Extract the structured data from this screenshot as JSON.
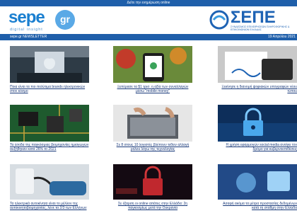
{
  "topbar": {
    "text": "Δείτε την ενημέρωση online"
  },
  "brand_left": {
    "word": "sepe",
    "badge": "gr",
    "tagline": "digital insight"
  },
  "brand_right": {
    "word": "ΣΕΠΕ",
    "sub": "ΣΥΝΔΕΣΜΟΣ ΕΠΙΧΕΙΡΗΣΕΩΝ ΠΛΗΡΟΦΟΡΙΚΗΣ & ΕΠΙΚΟΙΝΩΝΙΩΝ ΕΛΛΑΔΑΣ"
  },
  "newsbar": {
    "left": "sepe.gr NEWSLETTER",
    "right": "19 Απριλίου 2021"
  },
  "articles": [
    {
      "caption": "Ποια είναι τα πιο πολύτιμα brands ηλεκτρονικών στον κόσμο",
      "image": "apple-store-image"
    },
    {
      "caption": "Ξεπέρασε τα $1 τρισ. η αξία των συναλλαγών μέσω \"mobile money\"",
      "image": "mobile-payment-image"
    },
    {
      "caption": "Ξεκίνησε η διανομή ψηφιακών υπογραφών νέου τύπου",
      "image": "digital-signature-image"
    },
    {
      "caption": "Τα έσοδα της παγκόσμιας βιομηχανίας ημιαγωγών αυξήθηκαν κατά 26% το 2021",
      "image": "circuit-board-image"
    },
    {
      "caption": "Σε 8 στους 10 λογιστές βλέπουν τεθειν αλλαγή ρόλου λόγω της τεχνολογίας",
      "image": "laptop-typing-image"
    },
    {
      "caption": "Η χρήση εφαρμογών social media ανοίγει τον δρόμο για κυβερνοεπιθέσεις",
      "image": "cyber-lock-image"
    },
    {
      "caption": "Τα ηλεκτρικά αυτοκίνητα είναι το μέλλον της αυτοκινητοβιομηχανίας, λένε τα 2/3 των Ελλήνων",
      "image": "ev-charging-image"
    },
    {
      "caption": "Σε έξαρση οι online απάτες στην Ελλάδα: 2η παγκοσμίως μετά την Ουκρανία",
      "image": "red-padlock-image"
    },
    {
      "caption": "Ασαφή ακόμα τα μέτρα προστασίας δεδομένων κατά τη στάθμη στην Ελλάδα",
      "image": "data-protection-image"
    }
  ]
}
